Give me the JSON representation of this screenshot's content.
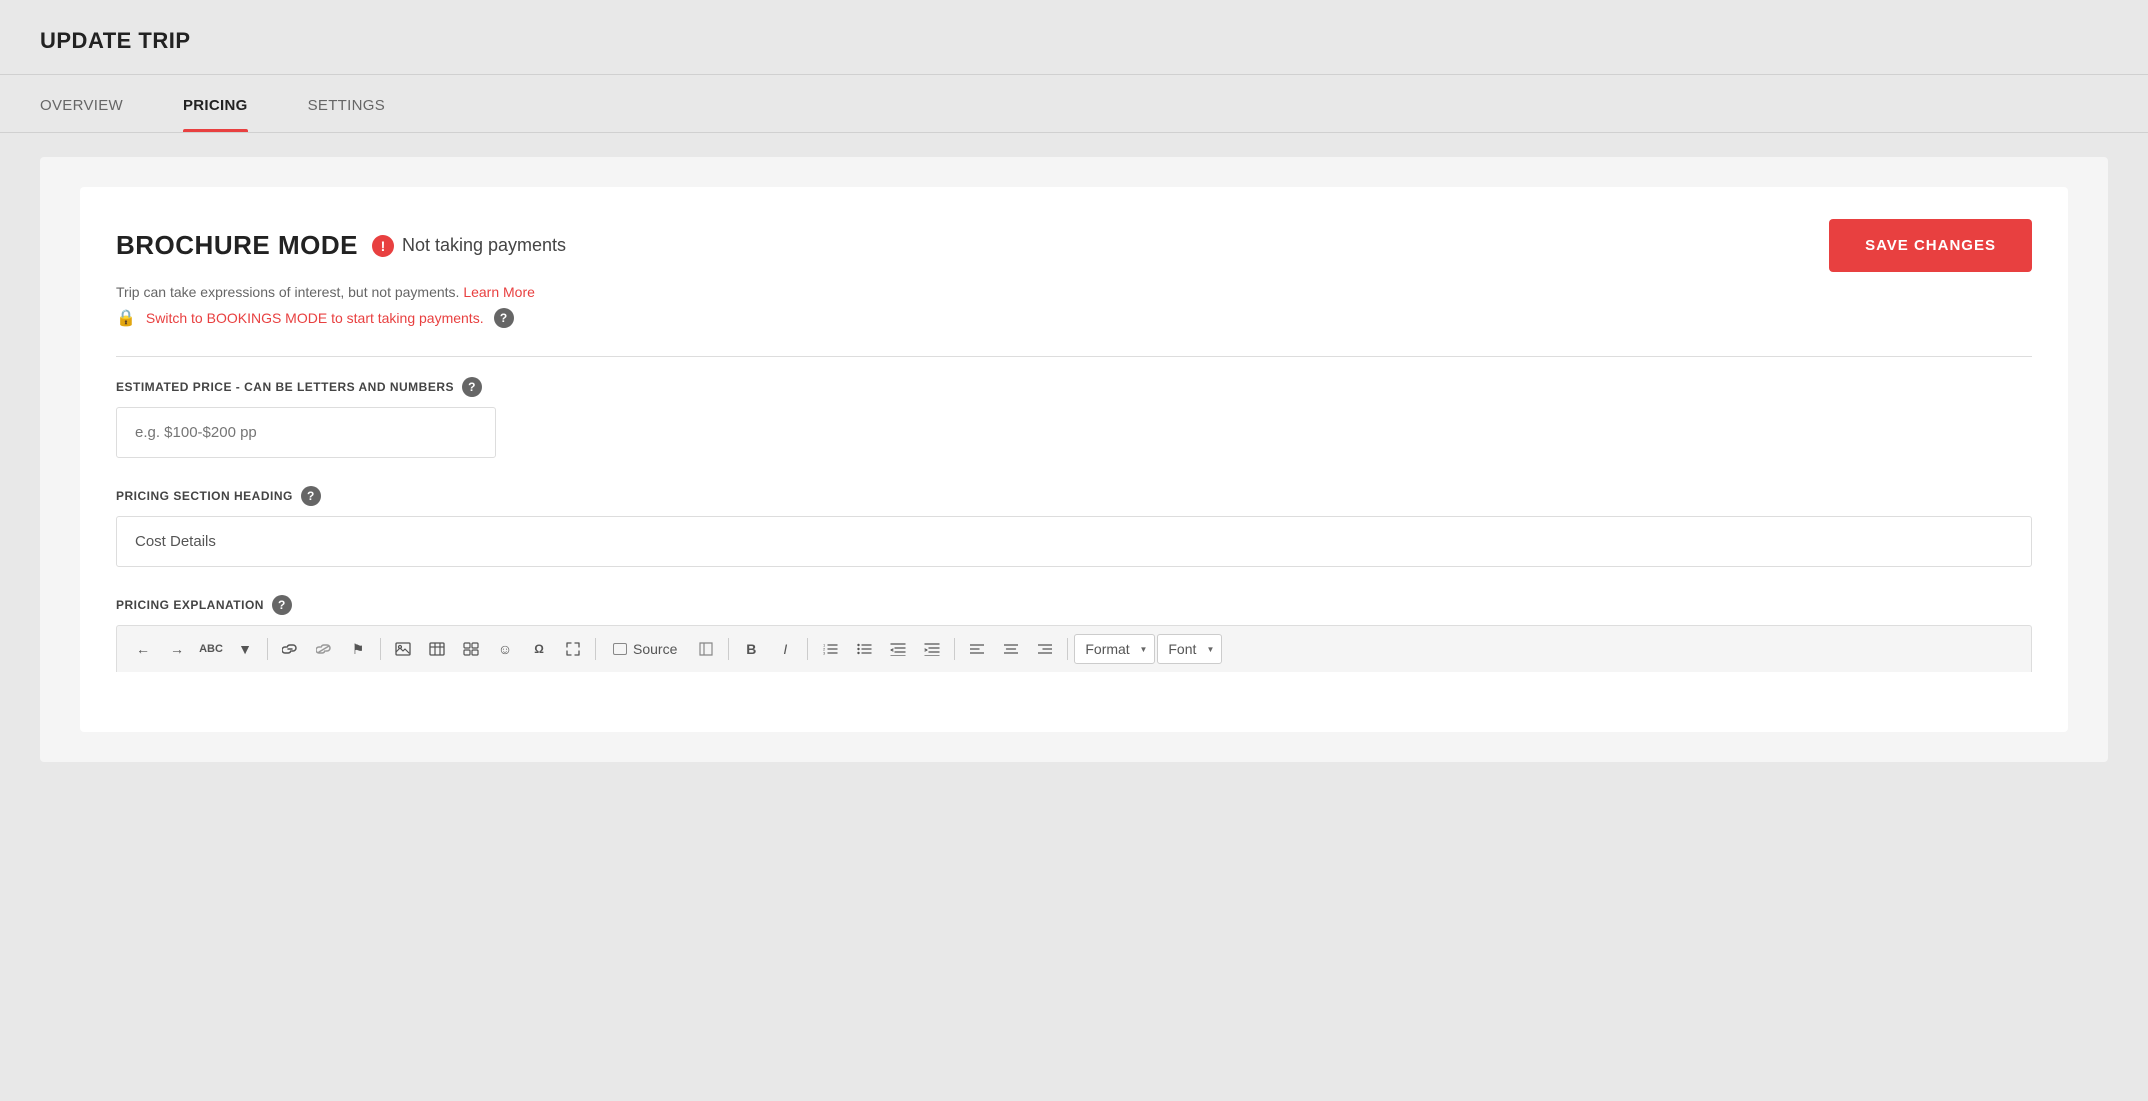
{
  "page": {
    "title": "UPDATE TRIP"
  },
  "tabs": [
    {
      "id": "overview",
      "label": "OVERVIEW",
      "active": false
    },
    {
      "id": "pricing",
      "label": "PRICING",
      "active": true
    },
    {
      "id": "settings",
      "label": "SETTINGS",
      "active": false
    }
  ],
  "brochure": {
    "title": "BROCHURE MODE",
    "status": "Not taking payments",
    "description": "Trip can take expressions of interest, but not payments.",
    "learn_more": "Learn More",
    "switch_mode": "Switch to BOOKINGS MODE to start taking payments.",
    "save_btn": "SAVE CHANGES"
  },
  "estimated_price": {
    "label": "ESTIMATED PRICE - CAN BE LETTERS AND NUMBERS",
    "placeholder": "e.g. $100-$200 pp",
    "value": ""
  },
  "pricing_heading": {
    "label": "PRICING SECTION HEADING",
    "value": "Cost Details"
  },
  "pricing_explanation": {
    "label": "PRICING EXPLANATION"
  },
  "toolbar": {
    "source_label": "Source",
    "bold_label": "B",
    "italic_label": "I",
    "format_label": "Format",
    "font_label": "Font"
  }
}
